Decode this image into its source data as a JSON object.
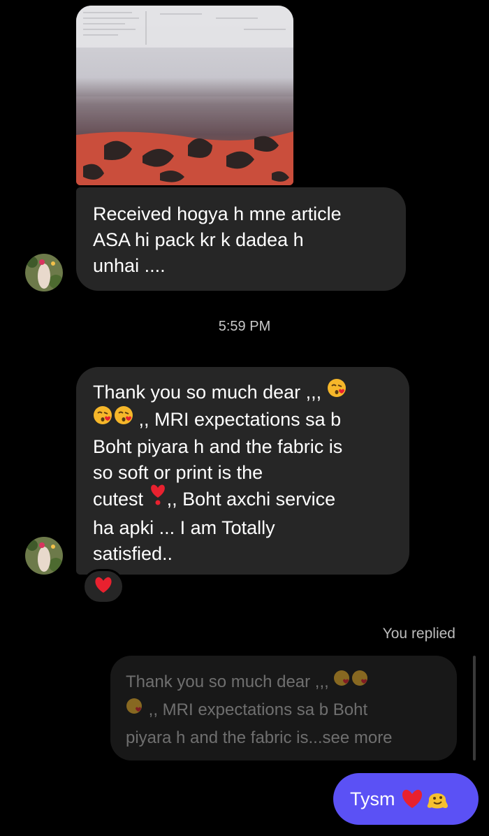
{
  "messages": {
    "received_1": {
      "text_line1": "Received hogya h mne article",
      "text_line2": "ASA hi pack kr k dadea h",
      "text_line3": "unhai ...."
    },
    "timestamp": "5:59 PM",
    "received_2": {
      "line1": "Thank you so much dear ,,,",
      "line2": ",, MRI expectations sa b",
      "line3": "Boht piyara h and the fabric is",
      "line4": "so soft or print is the",
      "line5a": "cutest",
      "line5b": ",, Boht axchi service",
      "line6": "ha apki ... I am Totally",
      "line7": "satisfied.."
    },
    "reaction_icon": "red-heart",
    "you_replied_label": "You replied",
    "quoted_reply": {
      "line1": "Thank you so much dear ,,,",
      "line2": ",, MRI expectations sa b Boht",
      "line3": "piyara h and the fabric is...see more"
    },
    "sent_message": {
      "text": "Tysm",
      "icons": [
        "red-heart",
        "melting-face"
      ]
    }
  },
  "colors": {
    "background": "#000000",
    "incoming_bubble": "#262626",
    "outgoing_bubble": "#5b51f5",
    "quoted_bubble": "#181818",
    "heart": "#e8212f"
  }
}
